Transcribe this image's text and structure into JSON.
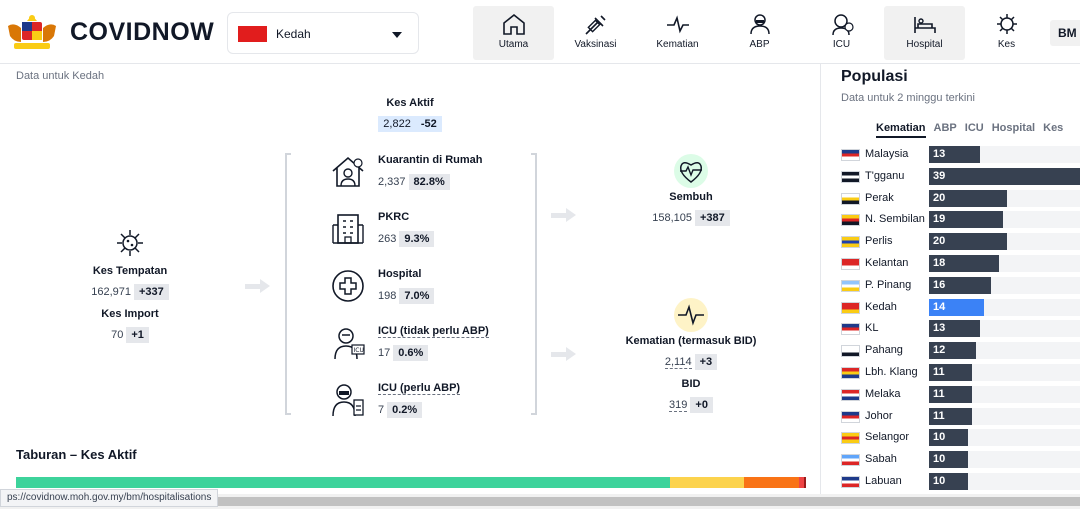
{
  "header": {
    "brand": "COVIDNOW",
    "state_selector": {
      "selected": "Kedah",
      "flag_color": "#e11d1d"
    },
    "nav": [
      {
        "label": "Utama",
        "icon": "home-icon",
        "active": true
      },
      {
        "label": "Vaksinasi",
        "icon": "syringe-icon",
        "active": false
      },
      {
        "label": "Kematian",
        "icon": "pulse-icon",
        "active": false
      },
      {
        "label": "ABP",
        "icon": "ppe-worker-icon",
        "active": false
      },
      {
        "label": "ICU",
        "icon": "icu-patient-icon",
        "active": false
      },
      {
        "label": "Hospital",
        "icon": "hospital-bed-icon",
        "active": true
      },
      {
        "label": "Kes",
        "icon": "virus-icon",
        "active": false
      }
    ],
    "language": "BM"
  },
  "flow": {
    "data_for": "Data untuk Kedah",
    "active": {
      "label": "Kes Aktif",
      "value": "2,822",
      "delta": "-52"
    },
    "local": {
      "label": "Kes Tempatan",
      "value": "162,971",
      "delta": "+337"
    },
    "import": {
      "label": "Kes Import",
      "value": "70",
      "delta": "+1"
    },
    "categories": [
      {
        "label": "Kuarantin di Rumah",
        "value": "2,337",
        "pct": "82.8%",
        "icon": "home-quarantine-icon",
        "underline": false
      },
      {
        "label": "PKRC",
        "value": "263",
        "pct": "9.3%",
        "icon": "building-icon",
        "underline": false
      },
      {
        "label": "Hospital",
        "value": "198",
        "pct": "7.0%",
        "icon": "medical-cross-icon",
        "underline": false
      },
      {
        "label": "ICU (tidak perlu ABP)",
        "value": "17",
        "pct": "0.6%",
        "icon": "icu-patient-icon",
        "underline": true
      },
      {
        "label": "ICU (perlu ABP)",
        "value": "7",
        "pct": "0.2%",
        "icon": "ventilator-patient-icon",
        "underline": true
      }
    ],
    "recovered": {
      "label": "Sembuh",
      "value": "158,105",
      "delta": "+387"
    },
    "deaths": {
      "label": "Kematian (termasuk BID)",
      "value": "2,114",
      "delta": "+3"
    },
    "bid": {
      "label": "BID",
      "value": "319",
      "delta": "+0"
    },
    "distribution_title": "Taburan – Kes Aktif",
    "distribution": [
      {
        "pct": 82.8,
        "color": "#3dd39b"
      },
      {
        "pct": 9.3,
        "color": "#fcd34d"
      },
      {
        "pct": 7.0,
        "color": "#f97316"
      },
      {
        "pct": 0.6,
        "color": "#ef4444"
      },
      {
        "pct": 0.3,
        "color": "#991b1b"
      }
    ]
  },
  "ranking": {
    "title": "Populasi",
    "subtitle": "Data untuk 2 minggu terkini",
    "tabs": [
      {
        "label": "Kematian",
        "active": true
      },
      {
        "label": "ABP",
        "active": false
      },
      {
        "label": "ICU",
        "active": false
      },
      {
        "label": "Hospital",
        "active": false
      },
      {
        "label": "Kes",
        "active": false
      }
    ],
    "max": 39,
    "rows": [
      {
        "name": "Malaysia",
        "value": 13,
        "flag": [
          "#1e3a8a",
          "#dc2626",
          "#ffffff"
        ]
      },
      {
        "name": "T'gganu",
        "value": 39,
        "flag": [
          "#111827",
          "#ffffff",
          "#111827"
        ]
      },
      {
        "name": "Perak",
        "value": 20,
        "flag": [
          "#ffffff",
          "#facc15",
          "#111827"
        ]
      },
      {
        "name": "N. Sembilan",
        "value": 19,
        "flag": [
          "#facc15",
          "#dc2626",
          "#111827"
        ]
      },
      {
        "name": "Perlis",
        "value": 20,
        "flag": [
          "#facc15",
          "#1e40af",
          "#facc15"
        ]
      },
      {
        "name": "Kelantan",
        "value": 18,
        "flag": [
          "#dc2626",
          "#dc2626",
          "#ffffff"
        ]
      },
      {
        "name": "P. Pinang",
        "value": 16,
        "flag": [
          "#93c5fd",
          "#ffffff",
          "#facc15"
        ]
      },
      {
        "name": "Kedah",
        "value": 14,
        "flag": [
          "#dc2626",
          "#dc2626",
          "#facc15"
        ],
        "highlight": true
      },
      {
        "name": "KL",
        "value": 13,
        "flag": [
          "#1e3a8a",
          "#dc2626",
          "#ffffff"
        ]
      },
      {
        "name": "Pahang",
        "value": 12,
        "flag": [
          "#ffffff",
          "#ffffff",
          "#111827"
        ]
      },
      {
        "name": "Lbh. Klang",
        "value": 11,
        "flag": [
          "#dc2626",
          "#facc15",
          "#1e3a8a"
        ]
      },
      {
        "name": "Melaka",
        "value": 11,
        "flag": [
          "#dc2626",
          "#ffffff",
          "#1e3a8a"
        ]
      },
      {
        "name": "Johor",
        "value": 11,
        "flag": [
          "#1e3a8a",
          "#dc2626",
          "#ffffff"
        ]
      },
      {
        "name": "Selangor",
        "value": 10,
        "flag": [
          "#facc15",
          "#dc2626",
          "#facc15"
        ]
      },
      {
        "name": "Sabah",
        "value": 10,
        "flag": [
          "#60a5fa",
          "#ffffff",
          "#dc2626"
        ]
      },
      {
        "name": "Labuan",
        "value": 10,
        "flag": [
          "#1e3a8a",
          "#ffffff",
          "#dc2626"
        ]
      }
    ]
  },
  "status_url": "ps://covidnow.moh.gov.my/bm/hospitalisations"
}
